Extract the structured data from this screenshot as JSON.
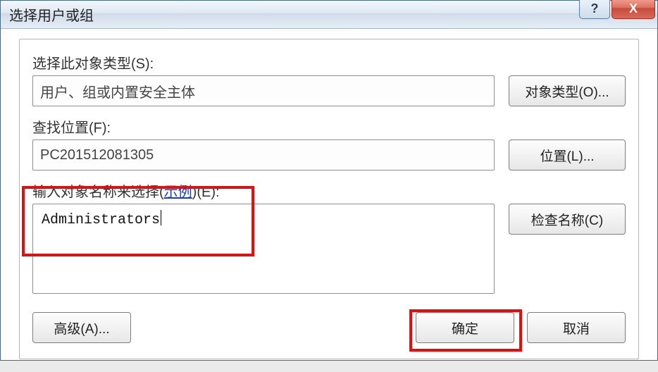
{
  "window": {
    "title": "选择用户或组"
  },
  "titlebar_controls": {
    "help": "?",
    "close": "X"
  },
  "sections": {
    "object_type": {
      "label": "选择此对象类型(S):",
      "value": "用户、组或内置安全主体",
      "button": "对象类型(O)..."
    },
    "location": {
      "label": "查找位置(F):",
      "value": "PC201512081305",
      "button": "位置(L)..."
    },
    "names": {
      "label_prefix": "输入对象名称来选择(",
      "label_link": "示例",
      "label_suffix": ")(E):",
      "value": "Administrators",
      "button": "检查名称(C)"
    }
  },
  "buttons": {
    "advanced": "高级(A)...",
    "ok": "确定",
    "cancel": "取消"
  }
}
